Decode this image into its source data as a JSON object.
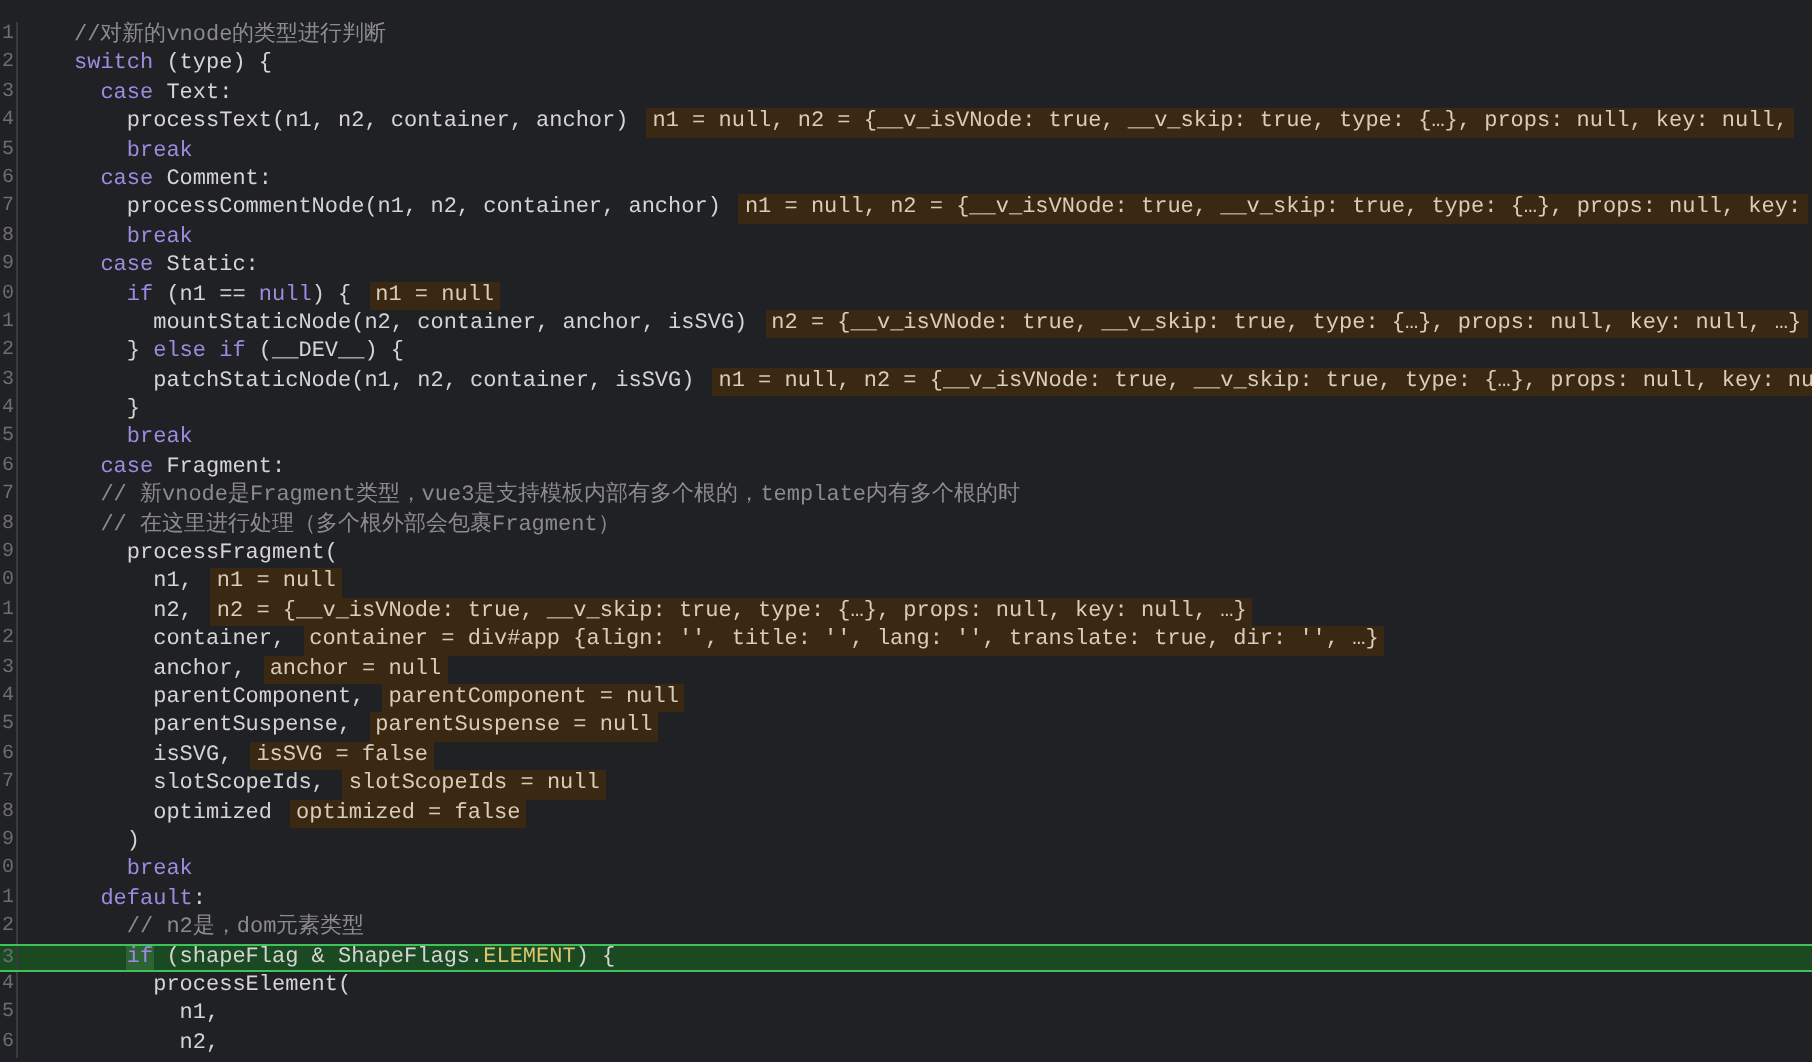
{
  "editor": {
    "lines": [
      {
        "number": "1",
        "current": false,
        "tokens": [
          {
            "kind": "comment",
            "text": "//对新的vnode的类型进行判断"
          }
        ]
      },
      {
        "number": "2",
        "current": false,
        "tokens": [
          {
            "kind": "keyword",
            "text": "switch"
          },
          {
            "kind": "plain",
            "text": " (type) {"
          }
        ],
        "children": [
          {
            "number": "3",
            "current": false,
            "tokens": [
              {
                "kind": "keyword",
                "text": "case"
              },
              {
                "kind": "plain",
                "text": " Text:"
              }
            ],
            "children": [
              {
                "number": "4",
                "current": false,
                "tokens": [
                  {
                    "kind": "plain",
                    "text": "processText(n1, n2, container, anchor)"
                  }
                ],
                "inline_value": "n1 = null, n2 = {__v_isVNode: true, __v_skip: true, type: {…}, props: null, key: null,"
              },
              {
                "number": "5",
                "current": false,
                "tokens": [
                  {
                    "kind": "keyword",
                    "text": "break"
                  }
                ]
              }
            ]
          },
          {
            "number": "6",
            "current": false,
            "tokens": [
              {
                "kind": "keyword",
                "text": "case"
              },
              {
                "kind": "plain",
                "text": " Comment:"
              }
            ],
            "children": [
              {
                "number": "7",
                "current": false,
                "tokens": [
                  {
                    "kind": "plain",
                    "text": "processCommentNode(n1, n2, container, anchor)"
                  }
                ],
                "inline_value": "n1 = null, n2 = {__v_isVNode: true, __v_skip: true, type: {…}, props: null, key:"
              },
              {
                "number": "8",
                "current": false,
                "tokens": [
                  {
                    "kind": "keyword",
                    "text": "break"
                  }
                ]
              }
            ]
          },
          {
            "number": "9",
            "current": false,
            "tokens": [
              {
                "kind": "keyword",
                "text": "case"
              },
              {
                "kind": "plain",
                "text": " Static:"
              }
            ],
            "children": [
              {
                "number": "0",
                "current": false,
                "tokens": [
                  {
                    "kind": "keyword",
                    "text": "if"
                  },
                  {
                    "kind": "plain",
                    "text": " (n1 == "
                  },
                  {
                    "kind": "keyword",
                    "text": "null"
                  },
                  {
                    "kind": "plain",
                    "text": ") {"
                  }
                ],
                "inline_value": "n1 = null",
                "children": [
                  {
                    "number": "1",
                    "current": false,
                    "tokens": [
                      {
                        "kind": "plain",
                        "text": "mountStaticNode(n2, container, anchor, isSVG)"
                      }
                    ],
                    "inline_value": "n2 = {__v_isVNode: true, __v_skip: true, type: {…}, props: null, key: null, …}"
                  }
                ]
              },
              {
                "number": "2",
                "current": false,
                "tokens": [
                  {
                    "kind": "plain",
                    "text": "} "
                  },
                  {
                    "kind": "keyword",
                    "text": "else if"
                  },
                  {
                    "kind": "plain",
                    "text": " (__DEV__) {"
                  }
                ],
                "children": [
                  {
                    "number": "3",
                    "current": false,
                    "tokens": [
                      {
                        "kind": "plain",
                        "text": "patchStaticNode(n1, n2, container, isSVG)"
                      }
                    ],
                    "inline_value": "n1 = null, n2 = {__v_isVNode: true, __v_skip: true, type: {…}, props: null, key: nu"
                  }
                ]
              },
              {
                "number": "4",
                "current": false,
                "tokens": [
                  {
                    "kind": "plain",
                    "text": "}"
                  }
                ]
              },
              {
                "number": "5",
                "current": false,
                "tokens": [
                  {
                    "kind": "keyword",
                    "text": "break"
                  }
                ]
              }
            ]
          },
          {
            "number": "6",
            "current": false,
            "tokens": [
              {
                "kind": "keyword",
                "text": "case"
              },
              {
                "kind": "plain",
                "text": " Fragment:"
              }
            ]
          },
          {
            "number": "7",
            "current": false,
            "tokens": [
              {
                "kind": "comment",
                "text": "// 新vnode是Fragment类型，vue3是支持模板内部有多个根的，template内有多个根的时"
              }
            ]
          },
          {
            "number": "8",
            "current": false,
            "tokens": [
              {
                "kind": "comment",
                "text": "// 在这里进行处理（多个根外部会包裹Fragment）"
              }
            ],
            "children": [
              {
                "number": "9",
                "current": false,
                "tokens": [
                  {
                    "kind": "plain",
                    "text": "processFragment("
                  }
                ],
                "children": [
                  {
                    "number": "0",
                    "current": false,
                    "tokens": [
                      {
                        "kind": "plain",
                        "text": "n1,"
                      }
                    ],
                    "inline_value": "n1 = null"
                  },
                  {
                    "number": "1",
                    "current": false,
                    "tokens": [
                      {
                        "kind": "plain",
                        "text": "n2,"
                      }
                    ],
                    "inline_value": "n2 = {__v_isVNode: true, __v_skip: true, type: {…}, props: null, key: null, …}"
                  },
                  {
                    "number": "2",
                    "current": false,
                    "tokens": [
                      {
                        "kind": "plain",
                        "text": "container,"
                      }
                    ],
                    "inline_value": "container = div#app {align: '', title: '', lang: '', translate: true, dir: '', …}"
                  },
                  {
                    "number": "3",
                    "current": false,
                    "tokens": [
                      {
                        "kind": "plain",
                        "text": "anchor,"
                      }
                    ],
                    "inline_value": "anchor = null"
                  },
                  {
                    "number": "4",
                    "current": false,
                    "tokens": [
                      {
                        "kind": "plain",
                        "text": "parentComponent,"
                      }
                    ],
                    "inline_value": "parentComponent = null"
                  },
                  {
                    "number": "5",
                    "current": false,
                    "tokens": [
                      {
                        "kind": "plain",
                        "text": "parentSuspense,"
                      }
                    ],
                    "inline_value": "parentSuspense = null"
                  },
                  {
                    "number": "6",
                    "current": false,
                    "tokens": [
                      {
                        "kind": "plain",
                        "text": "isSVG,"
                      }
                    ],
                    "inline_value": "isSVG = false"
                  },
                  {
                    "number": "7",
                    "current": false,
                    "tokens": [
                      {
                        "kind": "plain",
                        "text": "slotScopeIds,"
                      }
                    ],
                    "inline_value": "slotScopeIds = null"
                  },
                  {
                    "number": "8",
                    "current": false,
                    "tokens": [
                      {
                        "kind": "plain",
                        "text": "optimized"
                      }
                    ],
                    "inline_value": "optimized = false"
                  }
                ]
              },
              {
                "number": "9",
                "current": false,
                "tokens": [
                  {
                    "kind": "plain",
                    "text": ")"
                  }
                ]
              },
              {
                "number": "0",
                "current": false,
                "tokens": [
                  {
                    "kind": "keyword",
                    "text": "break"
                  }
                ]
              }
            ]
          },
          {
            "number": "1",
            "current": false,
            "tokens": [
              {
                "kind": "keyword",
                "text": "default"
              },
              {
                "kind": "plain",
                "text": ":"
              }
            ],
            "children": [
              {
                "number": "2",
                "current": false,
                "tokens": [
                  {
                    "kind": "comment",
                    "text": "// n2是，dom元素类型"
                  }
                ]
              },
              {
                "number": "3",
                "current": true,
                "tokens": [
                  {
                    "kind": "pointer",
                    "text": "if"
                  },
                  {
                    "kind": "plain",
                    "text": " (shapeFlag & ShapeFlags."
                  },
                  {
                    "kind": "constant",
                    "text": "ELEMENT"
                  },
                  {
                    "kind": "plain",
                    "text": ") {"
                  }
                ],
                "children": [
                  {
                    "number": "4",
                    "current": false,
                    "tokens": [
                      {
                        "kind": "plain",
                        "text": "processElement("
                      }
                    ],
                    "children": [
                      {
                        "number": "5",
                        "current": false,
                        "tokens": [
                          {
                            "kind": "plain",
                            "text": "n1,"
                          }
                        ]
                      },
                      {
                        "number": "6",
                        "current": false,
                        "tokens": [
                          {
                            "kind": "plain",
                            "text": "n2,"
                          }
                        ]
                      }
                    ]
                  }
                ]
              }
            ]
          }
        ]
      }
    ]
  }
}
